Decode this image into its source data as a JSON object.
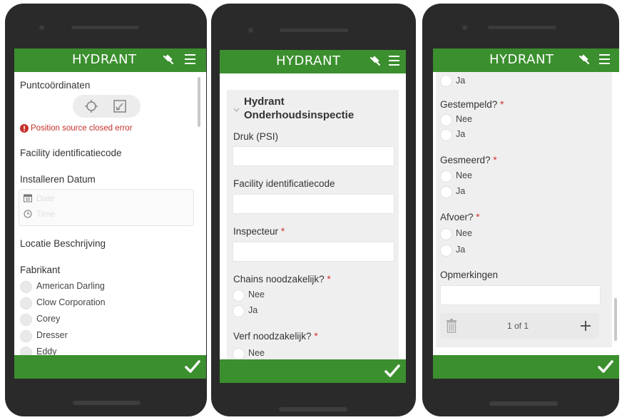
{
  "app_title": "HYDRANT",
  "colors": {
    "brand_green": "#3b8f2e",
    "error_red": "#c4302b",
    "required_star": "#d0312d"
  },
  "screen1": {
    "location_label": "Puntcoördinaten",
    "error_text": "Position source closed error",
    "facility_label": "Facility identificatiecode",
    "install_date_label": "Installeren Datum",
    "date_placeholder": "Date",
    "time_placeholder": "Time",
    "location_desc_label": "Locatie Beschrijving",
    "manufacturer_label": "Fabrikant",
    "manufacturers": [
      "American Darling",
      "Clow Corporation",
      "Corey",
      "Dresser",
      "Eddy"
    ]
  },
  "screen2": {
    "group_title_line1": "Hydrant",
    "group_title_line2": "Onderhoudsinspectie",
    "pressure_label": "Druk (PSI)",
    "facility_label": "Facility identificatiecode",
    "inspector_label": "Inspecteur",
    "chains_label": "Chains noodzakelijk?",
    "paint_label": "Verf noodzakelijk?",
    "opt_no": "Nee",
    "opt_yes": "Ja",
    "required_mark": "*"
  },
  "screen3": {
    "opt_yes": "Ja",
    "opt_no": "Nee",
    "stamped_label": "Gestempeld?",
    "lubricated_label": "Gesmeerd?",
    "drain_label": "Afvoer?",
    "remarks_label": "Opmerkingen",
    "page_indicator": "1 of 1",
    "required_mark": "*"
  }
}
